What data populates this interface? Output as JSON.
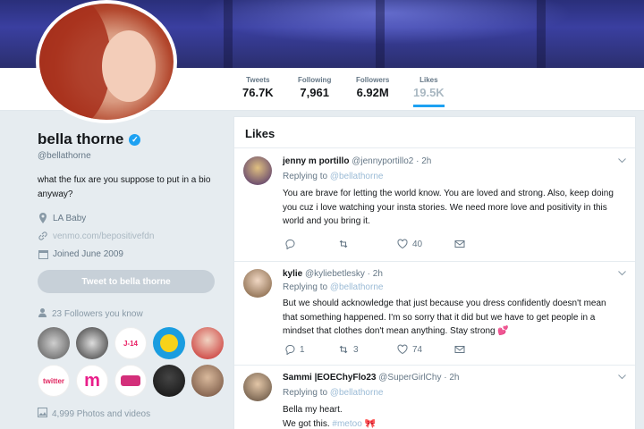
{
  "header": {
    "stats": [
      {
        "label": "Tweets",
        "value": "76.7K"
      },
      {
        "label": "Following",
        "value": "7,961"
      },
      {
        "label": "Followers",
        "value": "6.92M"
      },
      {
        "label": "Likes",
        "value": "19.5K"
      }
    ],
    "active_tab": "Likes"
  },
  "profile": {
    "name": "bella thorne",
    "handle": "@bellathorne",
    "bio": "what the fux are you suppose to put in a bio anyway?",
    "location": "LA Baby",
    "website": "venmo.com/bepositivefdn",
    "joined": "Joined June 2009",
    "tweet_to_button": "Tweet to bella thorne",
    "followers_you_know": "23 Followers you know",
    "follower_labels": [
      "",
      "",
      "J-14",
      "",
      "",
      "twitter",
      "m",
      "",
      "",
      ""
    ],
    "photos_videos": "4,999 Photos and videos"
  },
  "feed": {
    "title": "Likes",
    "tweets": [
      {
        "name": "jenny m portillo",
        "handle": "@jennyportillo2",
        "time": "· 2h",
        "replying_prefix": "Replying to",
        "replying_to": "@bellathorne",
        "text": "You are brave for letting the world know. You are loved and strong. Also, keep doing you cuz i love watching your insta stories. We need more love and positivity in this world and you bring it.",
        "replies": "",
        "retweets": "",
        "likes": "40"
      },
      {
        "name": "kylie",
        "handle": "@kyliebetlesky",
        "time": "· 2h",
        "replying_prefix": "Replying to",
        "replying_to": "@bellathorne",
        "text": "But we should acknowledge that just because you dress confidently doesn't mean that something happened. I'm so sorry that it did but we have to get people in a mindset that clothes don't mean anything. Stay strong",
        "emoji": "💕",
        "replies": "1",
        "retweets": "3",
        "likes": "74"
      },
      {
        "name": "Sammi |EOEChyFlo23",
        "handle": "@SuperGirlChy",
        "time": "· 2h",
        "replying_prefix": "Replying to",
        "replying_to": "@bellathorne",
        "line1": "Bella my heart.",
        "line2": "We got this.",
        "hashtag": "#metoo"
      }
    ]
  },
  "colors": {
    "accent": "#1da1f2",
    "banner": "#2a2f7a",
    "background": "#e6ecf0"
  }
}
